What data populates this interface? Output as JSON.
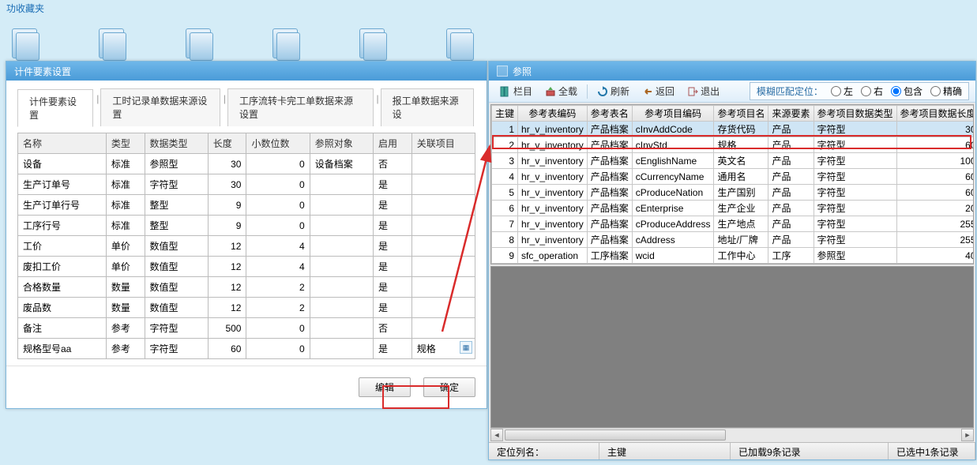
{
  "top_link": "功收藏夹",
  "left_dialog": {
    "title": "计件要素设置",
    "tabs": [
      "计件要素设置",
      "工时记录单数据来源设置",
      "工序流转卡完工单数据来源设置",
      "报工单数据来源设"
    ],
    "columns": [
      "名称",
      "类型",
      "数据类型",
      "长度",
      "小数位数",
      "参照对象",
      "启用",
      "关联项目"
    ],
    "rows": [
      {
        "name": "设备",
        "type": "标准",
        "dtype": "参照型",
        "len": "30",
        "dec": "0",
        "ref": "设备档案",
        "enabled": "否",
        "rel": ""
      },
      {
        "name": "生产订单号",
        "type": "标准",
        "dtype": "字符型",
        "len": "30",
        "dec": "0",
        "ref": "",
        "enabled": "是",
        "rel": ""
      },
      {
        "name": "生产订单行号",
        "type": "标准",
        "dtype": "整型",
        "len": "9",
        "dec": "0",
        "ref": "",
        "enabled": "是",
        "rel": ""
      },
      {
        "name": "工序行号",
        "type": "标准",
        "dtype": "整型",
        "len": "9",
        "dec": "0",
        "ref": "",
        "enabled": "是",
        "rel": ""
      },
      {
        "name": "工价",
        "type": "单价",
        "dtype": "数值型",
        "len": "12",
        "dec": "4",
        "ref": "",
        "enabled": "是",
        "rel": ""
      },
      {
        "name": "废扣工价",
        "type": "单价",
        "dtype": "数值型",
        "len": "12",
        "dec": "4",
        "ref": "",
        "enabled": "是",
        "rel": ""
      },
      {
        "name": "合格数量",
        "type": "数量",
        "dtype": "数值型",
        "len": "12",
        "dec": "2",
        "ref": "",
        "enabled": "是",
        "rel": ""
      },
      {
        "name": "废品数",
        "type": "数量",
        "dtype": "数值型",
        "len": "12",
        "dec": "2",
        "ref": "",
        "enabled": "是",
        "rel": ""
      },
      {
        "name": "备注",
        "type": "参考",
        "dtype": "字符型",
        "len": "500",
        "dec": "0",
        "ref": "",
        "enabled": "否",
        "rel": ""
      },
      {
        "name": "规格型号aa",
        "type": "参考",
        "dtype": "字符型",
        "len": "60",
        "dec": "0",
        "ref": "",
        "enabled": "是",
        "rel": "规格"
      }
    ],
    "btn_edit": "编辑",
    "btn_ok": "确定"
  },
  "right_dialog": {
    "title": "参照",
    "toolbar": {
      "col": "栏目",
      "all": "全载",
      "refresh": "刷新",
      "back": "返回",
      "exit": "退出"
    },
    "fuzzy": {
      "title": "模糊匹配定位：",
      "left": "左",
      "right": "右",
      "contain": "包含",
      "exact": "精确"
    },
    "columns": [
      "主键",
      "参考表编码",
      "参考表名",
      "参考项目编码",
      "参考项目名",
      "来源要素",
      "参考项目数据类型",
      "参考项目数据长度"
    ],
    "rows": [
      {
        "pk": "1",
        "code": "hr_v_inventory",
        "tname": "产品档案",
        "icode": "cInvAddCode",
        "iname": "存货代码",
        "src": "产品",
        "dtype": "字符型",
        "len": "30"
      },
      {
        "pk": "2",
        "code": "hr_v_inventory",
        "tname": "产品档案",
        "icode": "cInvStd",
        "iname": "规格",
        "src": "产品",
        "dtype": "字符型",
        "len": "60"
      },
      {
        "pk": "3",
        "code": "hr_v_inventory",
        "tname": "产品档案",
        "icode": "cEnglishName",
        "iname": "英文名",
        "src": "产品",
        "dtype": "字符型",
        "len": "100"
      },
      {
        "pk": "4",
        "code": "hr_v_inventory",
        "tname": "产品档案",
        "icode": "cCurrencyName",
        "iname": "通用名",
        "src": "产品",
        "dtype": "字符型",
        "len": "60"
      },
      {
        "pk": "5",
        "code": "hr_v_inventory",
        "tname": "产品档案",
        "icode": "cProduceNation",
        "iname": "生产国别",
        "src": "产品",
        "dtype": "字符型",
        "len": "60"
      },
      {
        "pk": "6",
        "code": "hr_v_inventory",
        "tname": "产品档案",
        "icode": "cEnterprise",
        "iname": "生产企业",
        "src": "产品",
        "dtype": "字符型",
        "len": "20"
      },
      {
        "pk": "7",
        "code": "hr_v_inventory",
        "tname": "产品档案",
        "icode": "cProduceAddress",
        "iname": "生产地点",
        "src": "产品",
        "dtype": "字符型",
        "len": "255"
      },
      {
        "pk": "8",
        "code": "hr_v_inventory",
        "tname": "产品档案",
        "icode": "cAddress",
        "iname": "地址/厂牌",
        "src": "产品",
        "dtype": "字符型",
        "len": "255"
      },
      {
        "pk": "9",
        "code": "sfc_operation",
        "tname": "工序档案",
        "icode": "wcid",
        "iname": "工作中心",
        "src": "工序",
        "dtype": "参照型",
        "len": "40"
      }
    ],
    "status": {
      "loc": "定位列名：",
      "key": "主键",
      "loaded": "已加载9条记录",
      "selected": "已选中1条记录"
    }
  }
}
